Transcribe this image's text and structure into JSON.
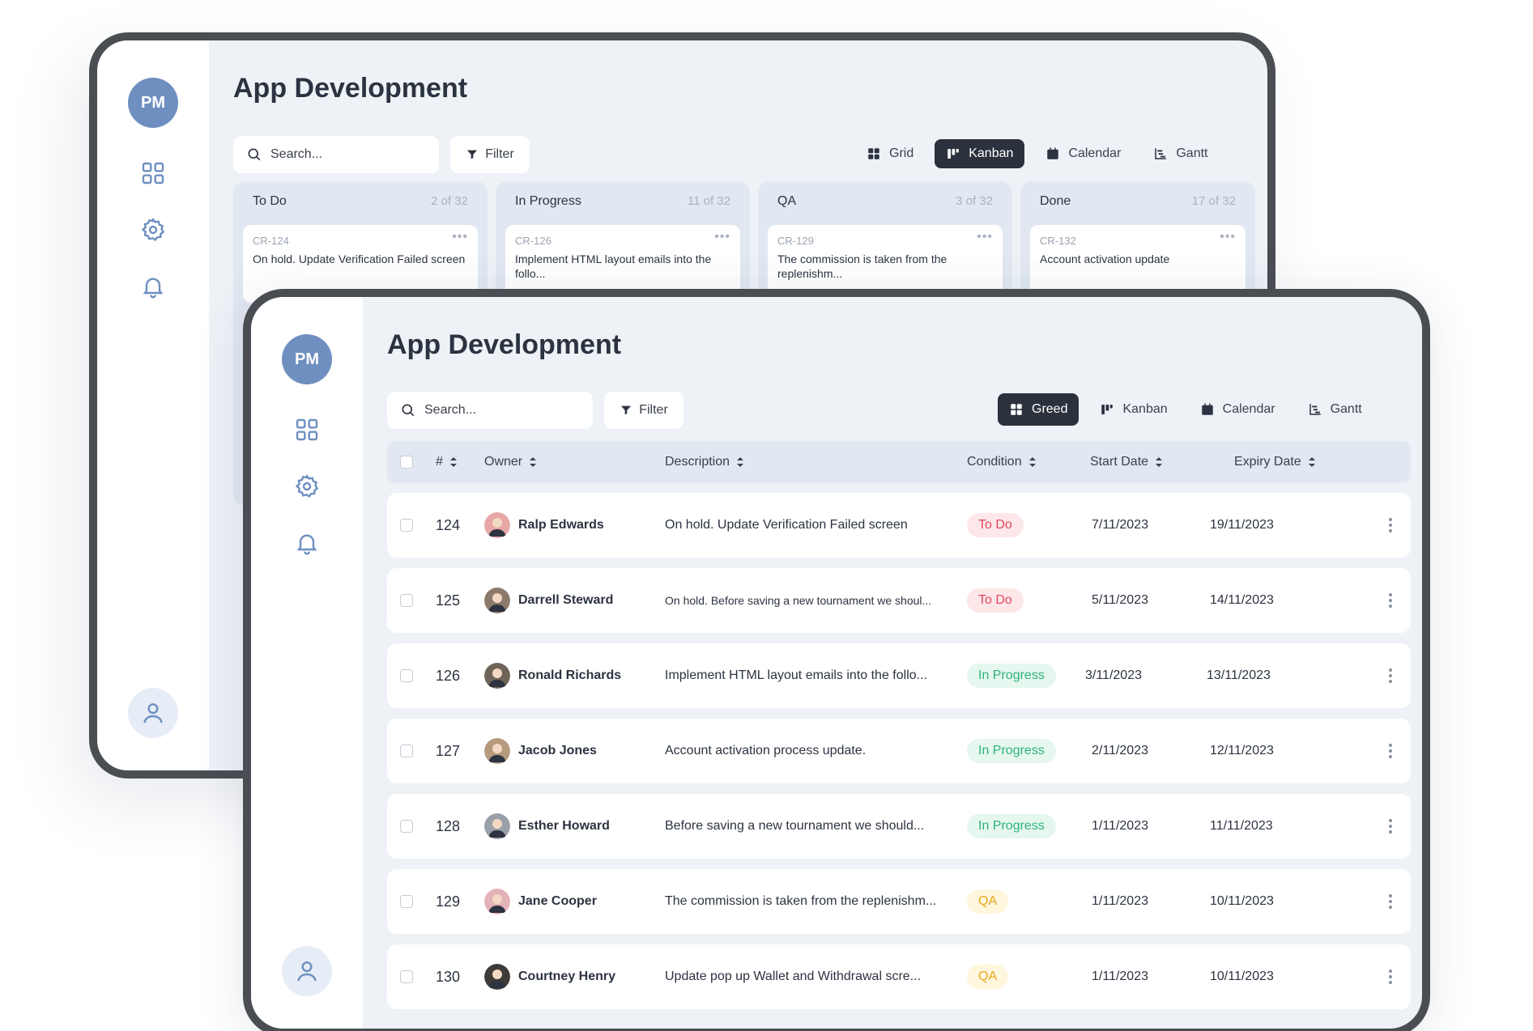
{
  "back": {
    "avatar_initials": "PM",
    "title": "App Development",
    "search_placeholder": "Search...",
    "filter_label": "Filter",
    "views": [
      {
        "label": "Grid",
        "active": false
      },
      {
        "label": "Kanban",
        "active": true
      },
      {
        "label": "Calendar",
        "active": false
      },
      {
        "label": "Gantt",
        "active": false
      }
    ],
    "columns": [
      {
        "name": "To Do",
        "count": "2 of 32",
        "card": {
          "id": "CR-124",
          "text": "On hold. Update Verification Failed screen"
        }
      },
      {
        "name": "In Progress",
        "count": "11 of 32",
        "card": {
          "id": "CR-126",
          "text": "Implement HTML layout emails into the follo..."
        }
      },
      {
        "name": "QA",
        "count": "3 of 32",
        "card": {
          "id": "CR-129",
          "text": "The commission is taken from the replenishm..."
        }
      },
      {
        "name": "Done",
        "count": "17 of 32",
        "card": {
          "id": "CR-132",
          "text": "Account activation update"
        }
      }
    ]
  },
  "front": {
    "avatar_initials": "PM",
    "title": "App Development",
    "search_placeholder": "Search...",
    "filter_label": "Filter",
    "views": [
      {
        "label": "Greed",
        "active": true
      },
      {
        "label": "Kanban",
        "active": false
      },
      {
        "label": "Calendar",
        "active": false
      },
      {
        "label": "Gantt",
        "active": false
      }
    ],
    "columns": {
      "id": "#",
      "owner": "Owner",
      "description": "Description",
      "condition": "Condition",
      "start": "Start Date",
      "expiry": "Expiry Date"
    },
    "rows": [
      {
        "id": "124",
        "owner": "Ralp Edwards",
        "description": "On hold. Update Verification Failed screen",
        "small": false,
        "condition": "To Do",
        "status": "todo",
        "start": "7/11/2023",
        "expiry": "19/11/2023",
        "avatar_color": "#e8a7a7"
      },
      {
        "id": "125",
        "owner": "Darrell Steward",
        "description": "On hold. Before saving a new tournament we shoul...",
        "small": true,
        "condition": "To Do",
        "status": "todo",
        "start": "5/11/2023",
        "expiry": "14/11/2023",
        "avatar_color": "#8c7a6b"
      },
      {
        "id": "126",
        "owner": "Ronald Richards",
        "description": "Implement HTML layout emails into the follo...",
        "small": false,
        "condition": "In Progress",
        "status": "prog",
        "start": "3/11/2023",
        "expiry": "13/11/2023",
        "avatar_color": "#6f6458"
      },
      {
        "id": "127",
        "owner": "Jacob Jones",
        "description": "Account activation process update.",
        "small": false,
        "condition": "In Progress",
        "status": "prog",
        "start": "2/11/2023",
        "expiry": "12/11/2023",
        "avatar_color": "#b59a7e"
      },
      {
        "id": "128",
        "owner": "Esther Howard",
        "description": "Before saving a new tournament we should...",
        "small": false,
        "condition": "In Progress",
        "status": "prog",
        "start": "1/11/2023",
        "expiry": "11/11/2023",
        "avatar_color": "#9aa0a8"
      },
      {
        "id": "129",
        "owner": "Jane Cooper",
        "description": "The commission is taken from the replenishm...",
        "small": false,
        "condition": "QA",
        "status": "qa",
        "start": "1/11/2023",
        "expiry": "10/11/2023",
        "avatar_color": "#e3b2b8"
      },
      {
        "id": "130",
        "owner": "Courtney Henry",
        "description": "Update pop up Wallet  and Withdrawal scre...",
        "small": false,
        "condition": "QA",
        "status": "qa",
        "start": "1/11/2023",
        "expiry": "10/11/2023",
        "avatar_color": "#3d3a38"
      }
    ]
  }
}
